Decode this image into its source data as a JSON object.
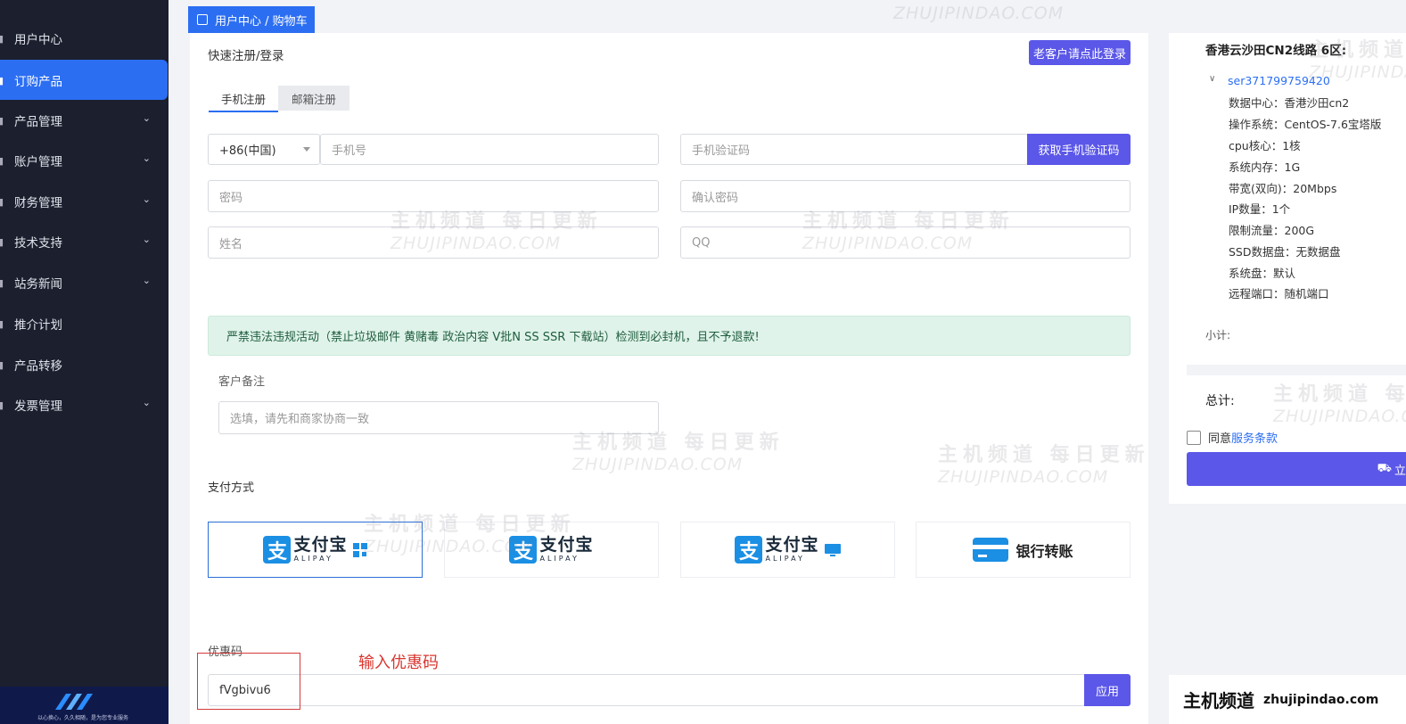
{
  "sidebar": {
    "items": [
      {
        "label": "用户中心",
        "chevron": false
      },
      {
        "label": "订购产品",
        "chevron": false,
        "active": true
      },
      {
        "label": "产品管理",
        "chevron": true
      },
      {
        "label": "账户管理",
        "chevron": true
      },
      {
        "label": "财务管理",
        "chevron": true
      },
      {
        "label": "技术支持",
        "chevron": true
      },
      {
        "label": "站务新闻",
        "chevron": true
      },
      {
        "label": "推介计划",
        "chevron": false
      },
      {
        "label": "产品转移",
        "chevron": false
      },
      {
        "label": "发票管理",
        "chevron": true
      }
    ],
    "logo_tagline": "以心换心，久久相随，是为您专业服务"
  },
  "breadcrumb": "用户中心 / 购物车",
  "form": {
    "section_title": "快速注册/登录",
    "login_button": "老客户请点此登录",
    "tabs": [
      "手机注册",
      "邮箱注册"
    ],
    "country_code": "+86(中国)",
    "phone_placeholder": "手机号",
    "sms_placeholder": "手机验证码",
    "sms_button": "获取手机验证码",
    "password_placeholder": "密码",
    "confirm_placeholder": "确认密码",
    "name_placeholder": "姓名",
    "qq_placeholder": "QQ",
    "notice": "严禁违法违规活动（禁止垃圾邮件 黄赌毒 政治内容 V批N SS SSR 下载站）检测到必封机，且不予退款!",
    "remark_label": "客户备注",
    "remark_placeholder": "选填，请先和商家协商一致",
    "payment_label": "支付方式",
    "payment_methods": [
      {
        "cn": "支付宝",
        "en": "ALIPAY",
        "icon": "alipay-icon",
        "extra": "qr-icon"
      },
      {
        "cn": "支付宝",
        "en": "ALIPAY",
        "icon": "alipay-icon",
        "extra": ""
      },
      {
        "cn": "支付宝",
        "en": "ALIPAY",
        "icon": "alipay-icon",
        "extra": "monitor-icon"
      },
      {
        "label": "银行转账",
        "icon": "bank-card-icon"
      }
    ],
    "coupon_label": "优惠码",
    "coupon_value": "fVgbivu6",
    "apply_button": "应用",
    "annotation": "输入优惠码"
  },
  "summary": {
    "title": "香港云沙田CN2线路 6区:",
    "server_id": "ser371799759420",
    "specs": [
      "数据中心：香港沙田cn2",
      "操作系统：CentOS-7.6宝塔版",
      "cpu核心：1核",
      "系统内存：1G",
      "带宽(双向)：20Mbps",
      "IP数量：1个",
      "限制流量：200G",
      "SSD数据盘：无数据盘",
      "系统盘：默认",
      "远程端口：随机端口"
    ],
    "subtotal_label": "小计:",
    "total_label": "总计:",
    "agree_prefix": "同意",
    "agree_link": "服务条款",
    "buy_button": "立"
  },
  "brand": {
    "cn": "主机频道",
    "en": "zhujipindao.com"
  },
  "watermark": {
    "cn": "主机频道 每日更新",
    "en": "ZHUJIPINDAO.COM"
  },
  "colors": {
    "accent": "#5b57e8",
    "primary": "#2b6ef2",
    "sidebar": "#1b1f2e"
  }
}
